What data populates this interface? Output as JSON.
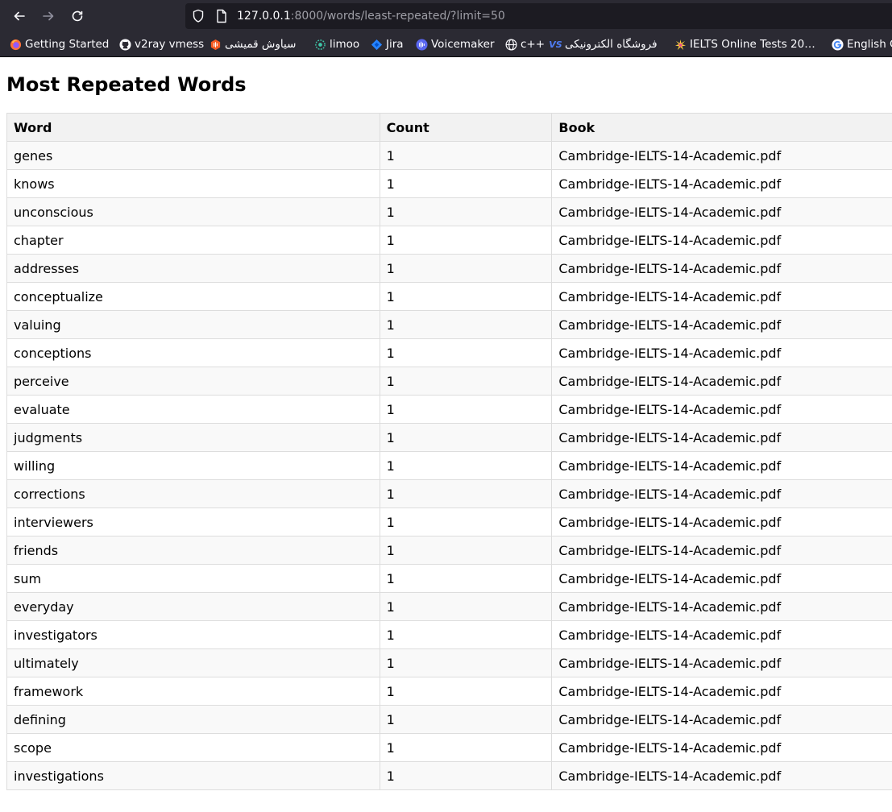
{
  "browser": {
    "url_host": "127.0.0.1",
    "url_rest": ":8000/words/least-repeated/?limit=50",
    "bookmarks": [
      {
        "label": "Getting Started",
        "icon": "firefox-icon"
      },
      {
        "label": "v2ray vmess",
        "icon": "github-icon"
      },
      {
        "label": "سیاوش قمیشی",
        "icon": "castbox-icon"
      },
      {
        "label": "limoo",
        "icon": "limoo-icon"
      },
      {
        "label": "Jira",
        "icon": "jira-icon"
      },
      {
        "label": "Voicemaker",
        "icon": "voicemaker-icon"
      },
      {
        "label": "c++",
        "icon": "globe-icon"
      },
      {
        "label": "فروشگاه الکترونیکی",
        "icon": "vs-icon"
      },
      {
        "label": "IELTS Online Tests 20…",
        "icon": "ielts-icon"
      },
      {
        "label": "English G",
        "icon": "google-icon"
      }
    ]
  },
  "page": {
    "title": "Most Repeated Words",
    "columns": [
      "Word",
      "Count",
      "Book"
    ],
    "rows": [
      [
        "genes",
        "1",
        "Cambridge-IELTS-14-Academic.pdf"
      ],
      [
        "knows",
        "1",
        "Cambridge-IELTS-14-Academic.pdf"
      ],
      [
        "unconscious",
        "1",
        "Cambridge-IELTS-14-Academic.pdf"
      ],
      [
        "chapter",
        "1",
        "Cambridge-IELTS-14-Academic.pdf"
      ],
      [
        "addresses",
        "1",
        "Cambridge-IELTS-14-Academic.pdf"
      ],
      [
        "conceptualize",
        "1",
        "Cambridge-IELTS-14-Academic.pdf"
      ],
      [
        "valuing",
        "1",
        "Cambridge-IELTS-14-Academic.pdf"
      ],
      [
        "conceptions",
        "1",
        "Cambridge-IELTS-14-Academic.pdf"
      ],
      [
        "perceive",
        "1",
        "Cambridge-IELTS-14-Academic.pdf"
      ],
      [
        "evaluate",
        "1",
        "Cambridge-IELTS-14-Academic.pdf"
      ],
      [
        "judgments",
        "1",
        "Cambridge-IELTS-14-Academic.pdf"
      ],
      [
        "willing",
        "1",
        "Cambridge-IELTS-14-Academic.pdf"
      ],
      [
        "corrections",
        "1",
        "Cambridge-IELTS-14-Academic.pdf"
      ],
      [
        "interviewers",
        "1",
        "Cambridge-IELTS-14-Academic.pdf"
      ],
      [
        "friends",
        "1",
        "Cambridge-IELTS-14-Academic.pdf"
      ],
      [
        "sum",
        "1",
        "Cambridge-IELTS-14-Academic.pdf"
      ],
      [
        "everyday",
        "1",
        "Cambridge-IELTS-14-Academic.pdf"
      ],
      [
        "investigators",
        "1",
        "Cambridge-IELTS-14-Academic.pdf"
      ],
      [
        "ultimately",
        "1",
        "Cambridge-IELTS-14-Academic.pdf"
      ],
      [
        "framework",
        "1",
        "Cambridge-IELTS-14-Academic.pdf"
      ],
      [
        "defining",
        "1",
        "Cambridge-IELTS-14-Academic.pdf"
      ],
      [
        "scope",
        "1",
        "Cambridge-IELTS-14-Academic.pdf"
      ],
      [
        "investigations",
        "1",
        "Cambridge-IELTS-14-Academic.pdf"
      ]
    ]
  }
}
